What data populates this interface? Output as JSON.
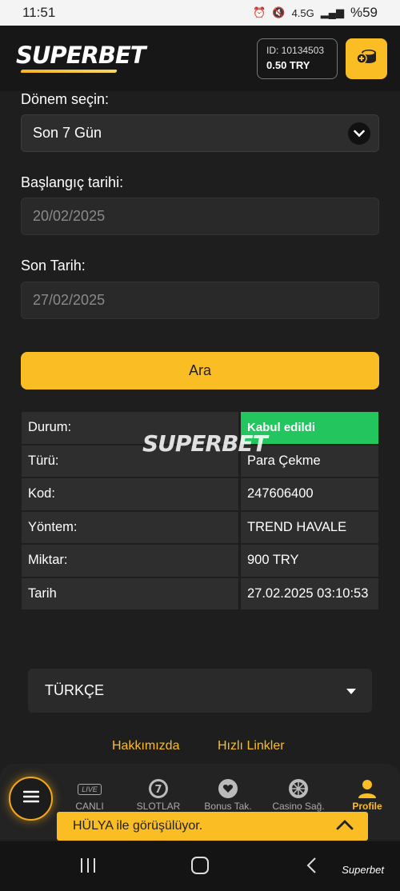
{
  "status_bar": {
    "time": "11:51",
    "network": "4.5G",
    "battery": "%59"
  },
  "header": {
    "logo_text_super": "SUPER",
    "logo_text_bet": "BET",
    "account_id": "ID: 10134503",
    "balance": "0.50 TRY",
    "wallet_icon": "coins-icon"
  },
  "filters": {
    "period_label": "Dönem seçin:",
    "period_value": "Son 7 Gün",
    "start_label": "Başlangıç tarihi:",
    "start_value": "20/02/2025",
    "end_label": "Son Tarih:",
    "end_value": "27/02/2025",
    "search_button": "Ara"
  },
  "result": {
    "watermark": "SUPERBET",
    "rows": [
      {
        "key": "Durum:",
        "value": "Kabul edildi"
      },
      {
        "key": "Türü:",
        "value": "Para Çekme"
      },
      {
        "key": "Kod:",
        "value": "247606400"
      },
      {
        "key": "Yöntem:",
        "value": "TREND HAVALE"
      },
      {
        "key": "Miktar:",
        "value": "900 TRY"
      },
      {
        "key": "Tarih",
        "value": "27.02.2025 03:10:53"
      }
    ],
    "status_color": "#22c55e"
  },
  "language": {
    "value": "TÜRKÇE"
  },
  "footer_links": {
    "about": "Hakkımızda",
    "quick": "Hızlı Linkler"
  },
  "bottom_nav": {
    "items": [
      {
        "label": "CANLI BAHİS",
        "icon": "live-icon"
      },
      {
        "label": "SLOTLAR",
        "icon": "slot-seven-icon"
      },
      {
        "label": "Bonus Tak.",
        "icon": "heart-icon"
      },
      {
        "label": "Casino Sağ.",
        "icon": "wheel-icon"
      },
      {
        "label": "Profile",
        "icon": "user-icon"
      }
    ],
    "live_badge": "LIVE"
  },
  "chat": {
    "text": "HÜLYA ile görüşülüyor."
  },
  "system_nav": {
    "brand": "Superbet"
  },
  "colors": {
    "accent": "#fbbd24",
    "background": "#1e1e1e",
    "success": "#22c55e"
  }
}
